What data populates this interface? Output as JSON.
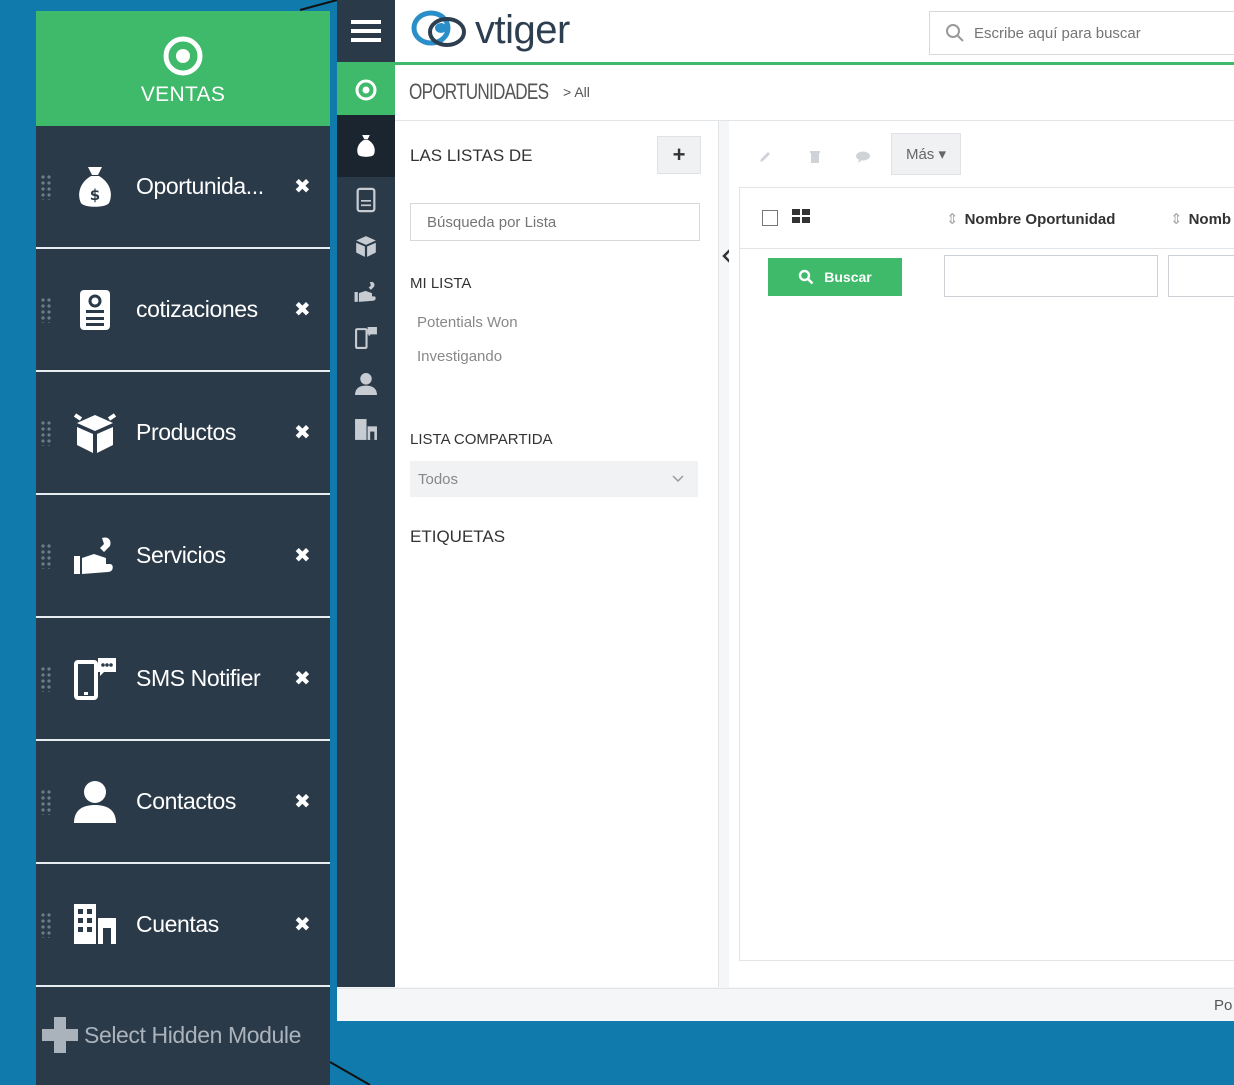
{
  "panel": {
    "title": "VENTAS",
    "modules": [
      {
        "label": "Oportunida...",
        "icon": "money-bag-icon"
      },
      {
        "label": "cotizaciones",
        "icon": "quote-icon"
      },
      {
        "label": "Productos",
        "icon": "box-icon"
      },
      {
        "label": "Servicios",
        "icon": "hand-wrench-icon"
      },
      {
        "label": "SMS Notifier",
        "icon": "sms-icon"
      },
      {
        "label": "Contactos",
        "icon": "person-icon"
      },
      {
        "label": "Cuentas",
        "icon": "building-icon"
      }
    ],
    "remove_glyph": "✖",
    "hidden_module_label": "Select Hidden Module"
  },
  "app": {
    "logo_text": "vtiger",
    "search_placeholder": "Escribe aquí para buscar",
    "breadcrumb": {
      "module": "OPORTUNIDADES",
      "separator": ">",
      "list": "All"
    },
    "lists": {
      "header": "LAS LISTAS DE",
      "add_label": "+",
      "search_placeholder": "Búsqueda por Lista",
      "my_list_title": "MI LISTA",
      "my_lists": [
        "Potentials Won",
        "Investigando"
      ],
      "shared_title": "LISTA COMPARTIDA",
      "shared_selected": "Todos",
      "tags_title": "ETIQUETAS"
    },
    "toolbar": {
      "more_label": "Más ▾"
    },
    "grid": {
      "columns": [
        "Nombre Oportunidad",
        "Nomb"
      ],
      "search_button": "Buscar"
    },
    "footer_text": "Po"
  },
  "colors": {
    "green": "#3fba6a",
    "navy": "#2b3a48",
    "blue_bg": "#0f7aab"
  }
}
